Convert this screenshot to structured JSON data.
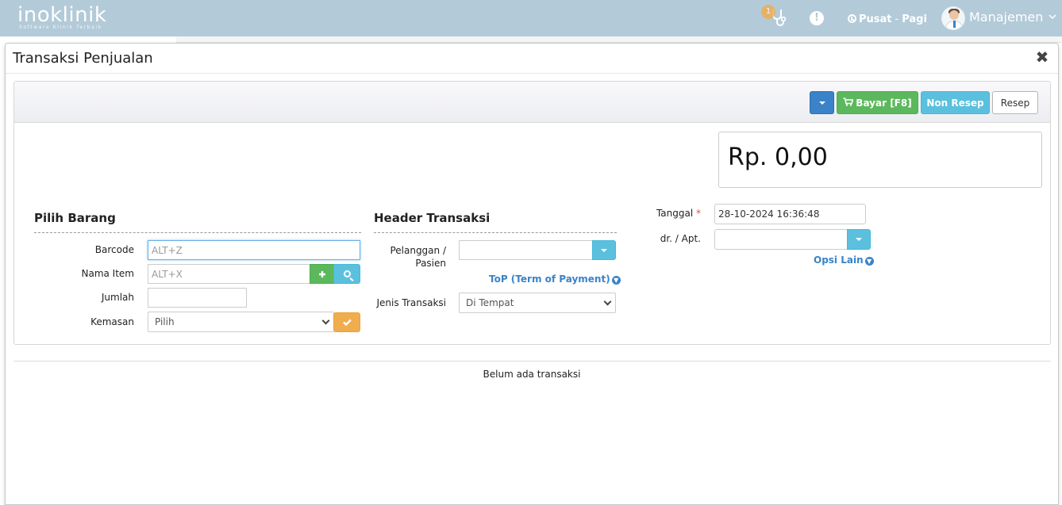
{
  "app": {
    "logo_text": "inoklinik",
    "logo_tagline": "Software Klinik Terbaik",
    "notification_count": "1",
    "alert_symbol": "!",
    "branch": "Pusat",
    "branch_separator": "-",
    "shift": "Pagi",
    "user": "Manajemen",
    "colors": {
      "topbar": "#b3cad9",
      "primary": "#3a83c8",
      "success": "#5cb85c",
      "info": "#5bc0de",
      "warning": "#f0ad4e"
    }
  },
  "modal": {
    "title": "Transaksi Penjualan",
    "close_symbol": "✖"
  },
  "toolbar": {
    "bayar_label": "Bayar [F8]",
    "non_resep_label": "Non Resep",
    "resep_label": "Resep"
  },
  "total": {
    "currency": "Rp.",
    "amount": "0,00"
  },
  "pilih_barang": {
    "title": "Pilih Barang",
    "barcode_label": "Barcode",
    "barcode_placeholder": "ALT+Z",
    "nama_item_label": "Nama Item",
    "nama_item_placeholder": "ALT+X",
    "jumlah_label": "Jumlah",
    "jumlah_value": "",
    "kemasan_label": "Kemasan",
    "kemasan_value": "Pilih"
  },
  "header_transaksi": {
    "title": "Header Transaksi",
    "pelanggan_label_1": "Pelanggan /",
    "pelanggan_label_2": "Pasien",
    "pelanggan_value": "",
    "top_link": "ToP (Term of Payment)",
    "jenis_label": "Jenis Transaksi",
    "jenis_value": "Di Tempat"
  },
  "info": {
    "tanggal_label": "Tanggal",
    "required_mark": "*",
    "tanggal_value": "28-10-2024 16:36:48",
    "dokter_label": "dr. / Apt.",
    "dokter_value": "",
    "opsi_lain_link": "Opsi Lain"
  },
  "transactions": {
    "empty_message": "Belum ada transaksi"
  }
}
